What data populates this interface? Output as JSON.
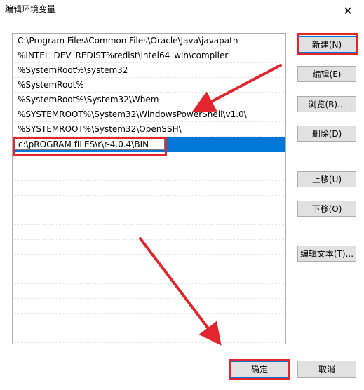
{
  "window": {
    "title": "编辑环境变量",
    "close_glyph": "✕"
  },
  "paths": [
    "C:\\Program Files\\Common Files\\Oracle\\Java\\javapath",
    "%INTEL_DEV_REDIST%redist\\intel64_win\\compiler",
    "%SystemRoot%\\system32",
    "%SystemRoot%",
    "%SystemRoot%\\System32\\Wbem",
    "%SYSTEMROOT%\\System32\\WindowsPowerShell\\v1.0\\",
    "%SYSTEMROOT%\\System32\\OpenSSH\\"
  ],
  "new_entry": "c:\\pROGRAM fILES\\r\\r-4.0.4\\BIN",
  "buttons": {
    "new": "新建(N)",
    "edit": "编辑(E)",
    "browse": "浏览(B)...",
    "delete": "删除(D)",
    "move_up": "上移(U)",
    "move_down": "下移(O)",
    "edit_text": "编辑文本(T)...",
    "ok": "确定",
    "cancel": "取消"
  },
  "colors": {
    "selection": "#0078d7",
    "annotation": "#e3262e"
  }
}
